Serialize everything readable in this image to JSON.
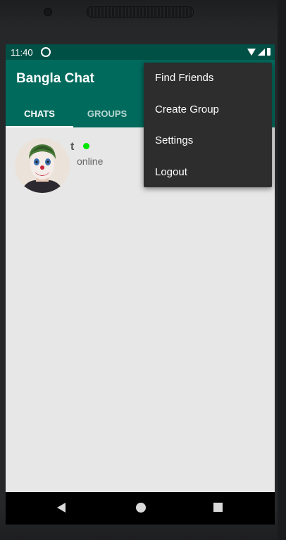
{
  "status_bar": {
    "time": "11:40",
    "icons": [
      "sync-circle-icon",
      "wifi-icon",
      "signal-icon",
      "battery-icon"
    ]
  },
  "app_bar": {
    "title": "Bangla Chat",
    "tabs": [
      {
        "label": "CHATS",
        "selected": true
      },
      {
        "label": "GROUPS",
        "selected": false
      }
    ],
    "colors": {
      "primary": "#006a5d",
      "status": "#005046",
      "indicator": "#ffffff"
    }
  },
  "chats": [
    {
      "name": "t",
      "status": "online",
      "online_color": "#00e600",
      "avatar": "clown-face-avatar"
    }
  ],
  "overflow_menu": {
    "items": [
      "Find Friends",
      "Create Group",
      "Settings",
      "Logout"
    ]
  },
  "nav_bar": {
    "icons": [
      "back-icon",
      "home-icon",
      "recents-icon"
    ]
  }
}
